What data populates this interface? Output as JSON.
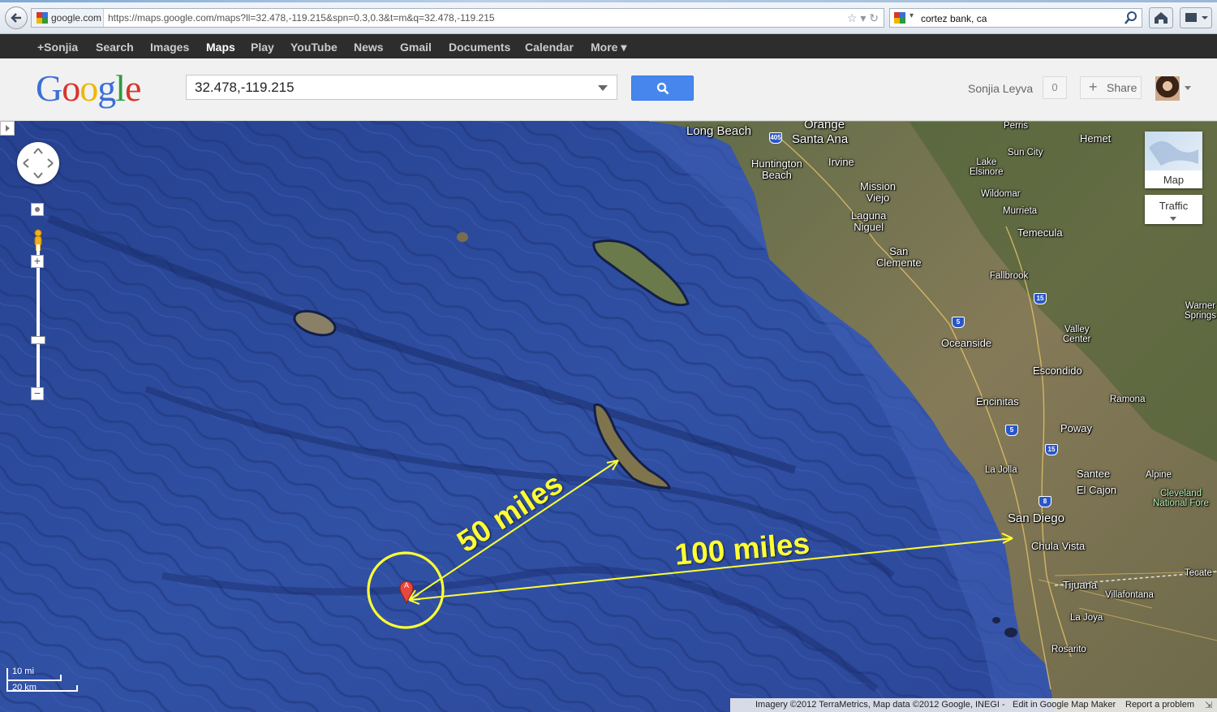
{
  "browser": {
    "site_chip": "google.com",
    "url": "https://maps.google.com/maps?ll=32.478,-119.215&spn=0.3,0.3&t=m&q=32.478,-119.215",
    "search_box_value": "cortez bank, ca"
  },
  "gbar": {
    "items": [
      "+Sonjia",
      "Search",
      "Images",
      "Maps",
      "Play",
      "YouTube",
      "News",
      "Gmail",
      "Documents",
      "Calendar",
      "More ▾"
    ],
    "active": "Maps"
  },
  "header": {
    "logo_letters": [
      "G",
      "o",
      "o",
      "g",
      "l",
      "e"
    ],
    "query_value": "32.478,-119.215",
    "user_name": "Sonjia Leyva",
    "notification_count": "0",
    "share_label": "Share"
  },
  "map": {
    "places": {
      "long_beach": "Long Beach",
      "orange": "Orange",
      "santa_ana": "Santa Ana",
      "huntington_beach_1": "Huntington",
      "huntington_beach_2": "Beach",
      "irvine": "Irvine",
      "mission_viejo_1": "Mission",
      "mission_viejo_2": "Viejo",
      "laguna_niguel_1": "Laguna",
      "laguna_niguel_2": "Niguel",
      "san_clemente_1": "San",
      "san_clemente_2": "Clemente",
      "perris": "Perris",
      "hemet": "Hemet",
      "sun_city": "Sun City",
      "lake_elsinore_1": "Lake",
      "lake_elsinore_2": "Elsinore",
      "wildomar": "Wildomar",
      "murrieta": "Murrieta",
      "temecula": "Temecula",
      "fallbrook": "Fallbrook",
      "warner_springs_1": "Warner",
      "warner_springs_2": "Springs",
      "valley_center_1": "Valley",
      "valley_center_2": "Center",
      "oceanside": "Oceanside",
      "escondido": "Escondido",
      "ramona": "Ramona",
      "encinitas": "Encinitas",
      "poway": "Poway",
      "la_jolla": "La Jolla",
      "santee": "Santee",
      "el_cajon": "El Cajon",
      "alpine": "Alpine",
      "cleveland_1": "Cleveland",
      "cleveland_2": "National Fore",
      "san_diego": "San Diego",
      "chula_vista": "Chula Vista",
      "tijuana": "Tijuana",
      "tecate": "Tecate",
      "villafontana": "Villafontana",
      "la_joya": "La Joya",
      "rosarito": "Rosarito"
    },
    "shields": [
      "405",
      "5",
      "15",
      "5",
      "15",
      "8"
    ],
    "map_type_label": "Map",
    "traffic_label": "Traffic",
    "marker_letter": "A",
    "scale": {
      "imperial": "10 mi",
      "metric": "20 km"
    },
    "copyright": "Imagery ©2012 TerraMetrics, Map data ©2012 Google, INEGI -",
    "edit_link": "Edit in Google Map Maker",
    "report_link": "Report a problem"
  },
  "annotations": {
    "label_50": "50 miles",
    "label_100": "100 miles",
    "color": "#ffff33"
  },
  "colors": {
    "ocean": "#2e4a9a",
    "land": "#6f7a4a",
    "gbar": "#2d2d2d",
    "search_button": "#4787ed"
  }
}
